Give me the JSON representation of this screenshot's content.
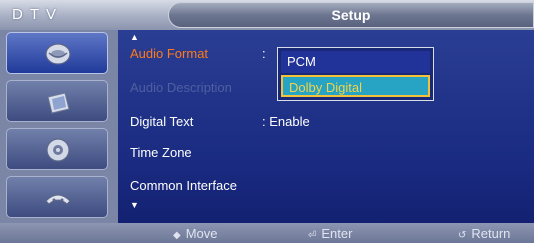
{
  "header": {
    "mode_label": "DTV",
    "title": "Setup"
  },
  "sidebar": {
    "items": [
      {
        "icon": "satellite-dish-icon",
        "active": true
      },
      {
        "icon": "picture-icon",
        "active": false
      },
      {
        "icon": "settings-gear-icon",
        "active": false
      },
      {
        "icon": "input-plug-icon",
        "active": false
      }
    ]
  },
  "menu": {
    "rows": [
      {
        "label": "Audio Format",
        "value": ":",
        "state": "selected"
      },
      {
        "label": "Audio Description",
        "value": "",
        "state": "disabled"
      },
      {
        "label": "Digital Text",
        "value": ": Enable",
        "state": "normal"
      },
      {
        "label": "Time Zone",
        "value": "",
        "state": "normal"
      },
      {
        "label": "Common Interface",
        "value": "",
        "state": "normal"
      }
    ],
    "scroll_up_glyph": "▲",
    "scroll_down_glyph": "▼"
  },
  "dropdown": {
    "options": [
      "PCM",
      "Dolby Digital"
    ],
    "highlighted": "Dolby Digital"
  },
  "help": {
    "move": {
      "glyph": "◆",
      "label": "Move"
    },
    "enter": {
      "glyph": "⏎",
      "label": "Enter"
    },
    "return": {
      "glyph": "↺",
      "label": "Return"
    }
  },
  "colors": {
    "selected_text": "#ff7a1a",
    "highlight_bg": "#27a3c4",
    "highlight_border": "#f2c23a"
  }
}
